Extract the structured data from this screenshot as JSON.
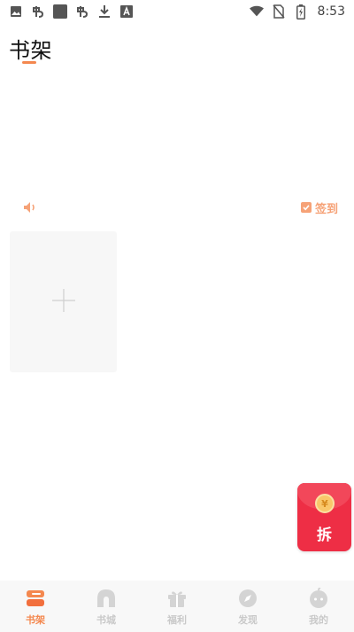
{
  "status_bar": {
    "time": "8:53",
    "left_icons": [
      "image-icon",
      "app-icon",
      "square-icon",
      "app-icon",
      "download-icon",
      "text-icon"
    ],
    "right_icons": [
      "wifi-icon",
      "no-sim-icon",
      "battery-charging-icon"
    ]
  },
  "header": {
    "title": "书架"
  },
  "notice": {
    "icon": "speaker-icon",
    "checkin_label": "签到"
  },
  "shelf": {
    "add_icon": "plus-icon"
  },
  "red_envelope": {
    "label": "拆",
    "coin_symbol": "¥"
  },
  "bottom_nav": {
    "items": [
      {
        "label": "书架",
        "icon": "bookshelf-icon",
        "active": true
      },
      {
        "label": "书城",
        "icon": "bookstore-icon",
        "active": false
      },
      {
        "label": "福利",
        "icon": "gift-icon",
        "active": false
      },
      {
        "label": "发现",
        "icon": "discover-icon",
        "active": false
      },
      {
        "label": "我的",
        "icon": "profile-icon",
        "active": false
      }
    ]
  },
  "colors": {
    "accent": "#f4884f",
    "checkin": "#f6a277",
    "envelope": "#ee2e45",
    "nav_inactive": "#c9c9c9"
  }
}
